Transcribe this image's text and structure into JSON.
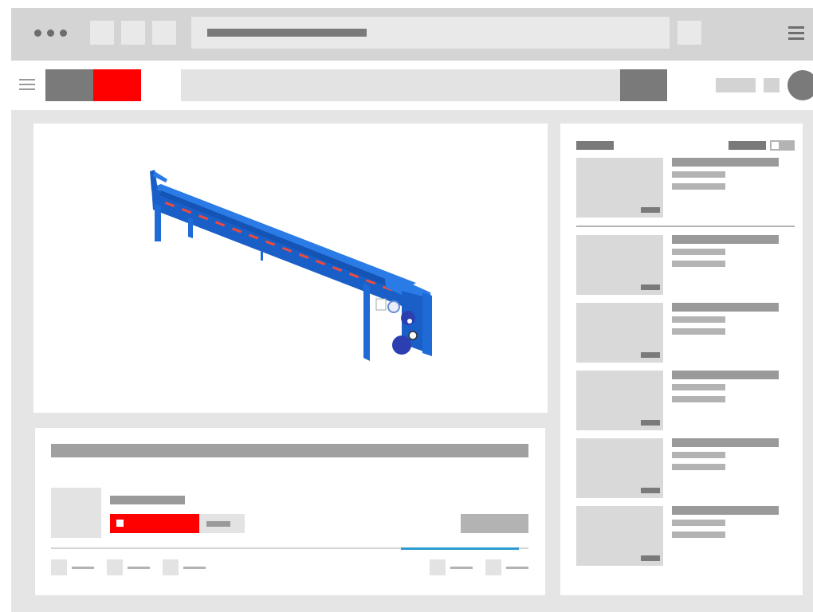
{
  "colors": {
    "brand_red": "#ff0000",
    "progress_blue": "#2b9bd0",
    "placeholder_dark": "#7a7a7a",
    "placeholder_light": "#d9d9d9",
    "conveyor_blue": "#1f6fe0",
    "conveyor_rollers": "#f04a3a"
  },
  "icons": {
    "window_dots": "traffic-dots-icon",
    "browser_menu": "hamburger-icon",
    "site_menu": "hamburger-icon",
    "subscribe_check": "checkbox-icon"
  },
  "video": {
    "subject": "conveyor-render"
  },
  "info": {
    "progress": 0.98
  },
  "sidebar": {
    "items": [
      {
        "id": 1
      },
      {
        "id": 2
      },
      {
        "id": 3
      },
      {
        "id": 4
      },
      {
        "id": 5
      },
      {
        "id": 6
      }
    ]
  }
}
